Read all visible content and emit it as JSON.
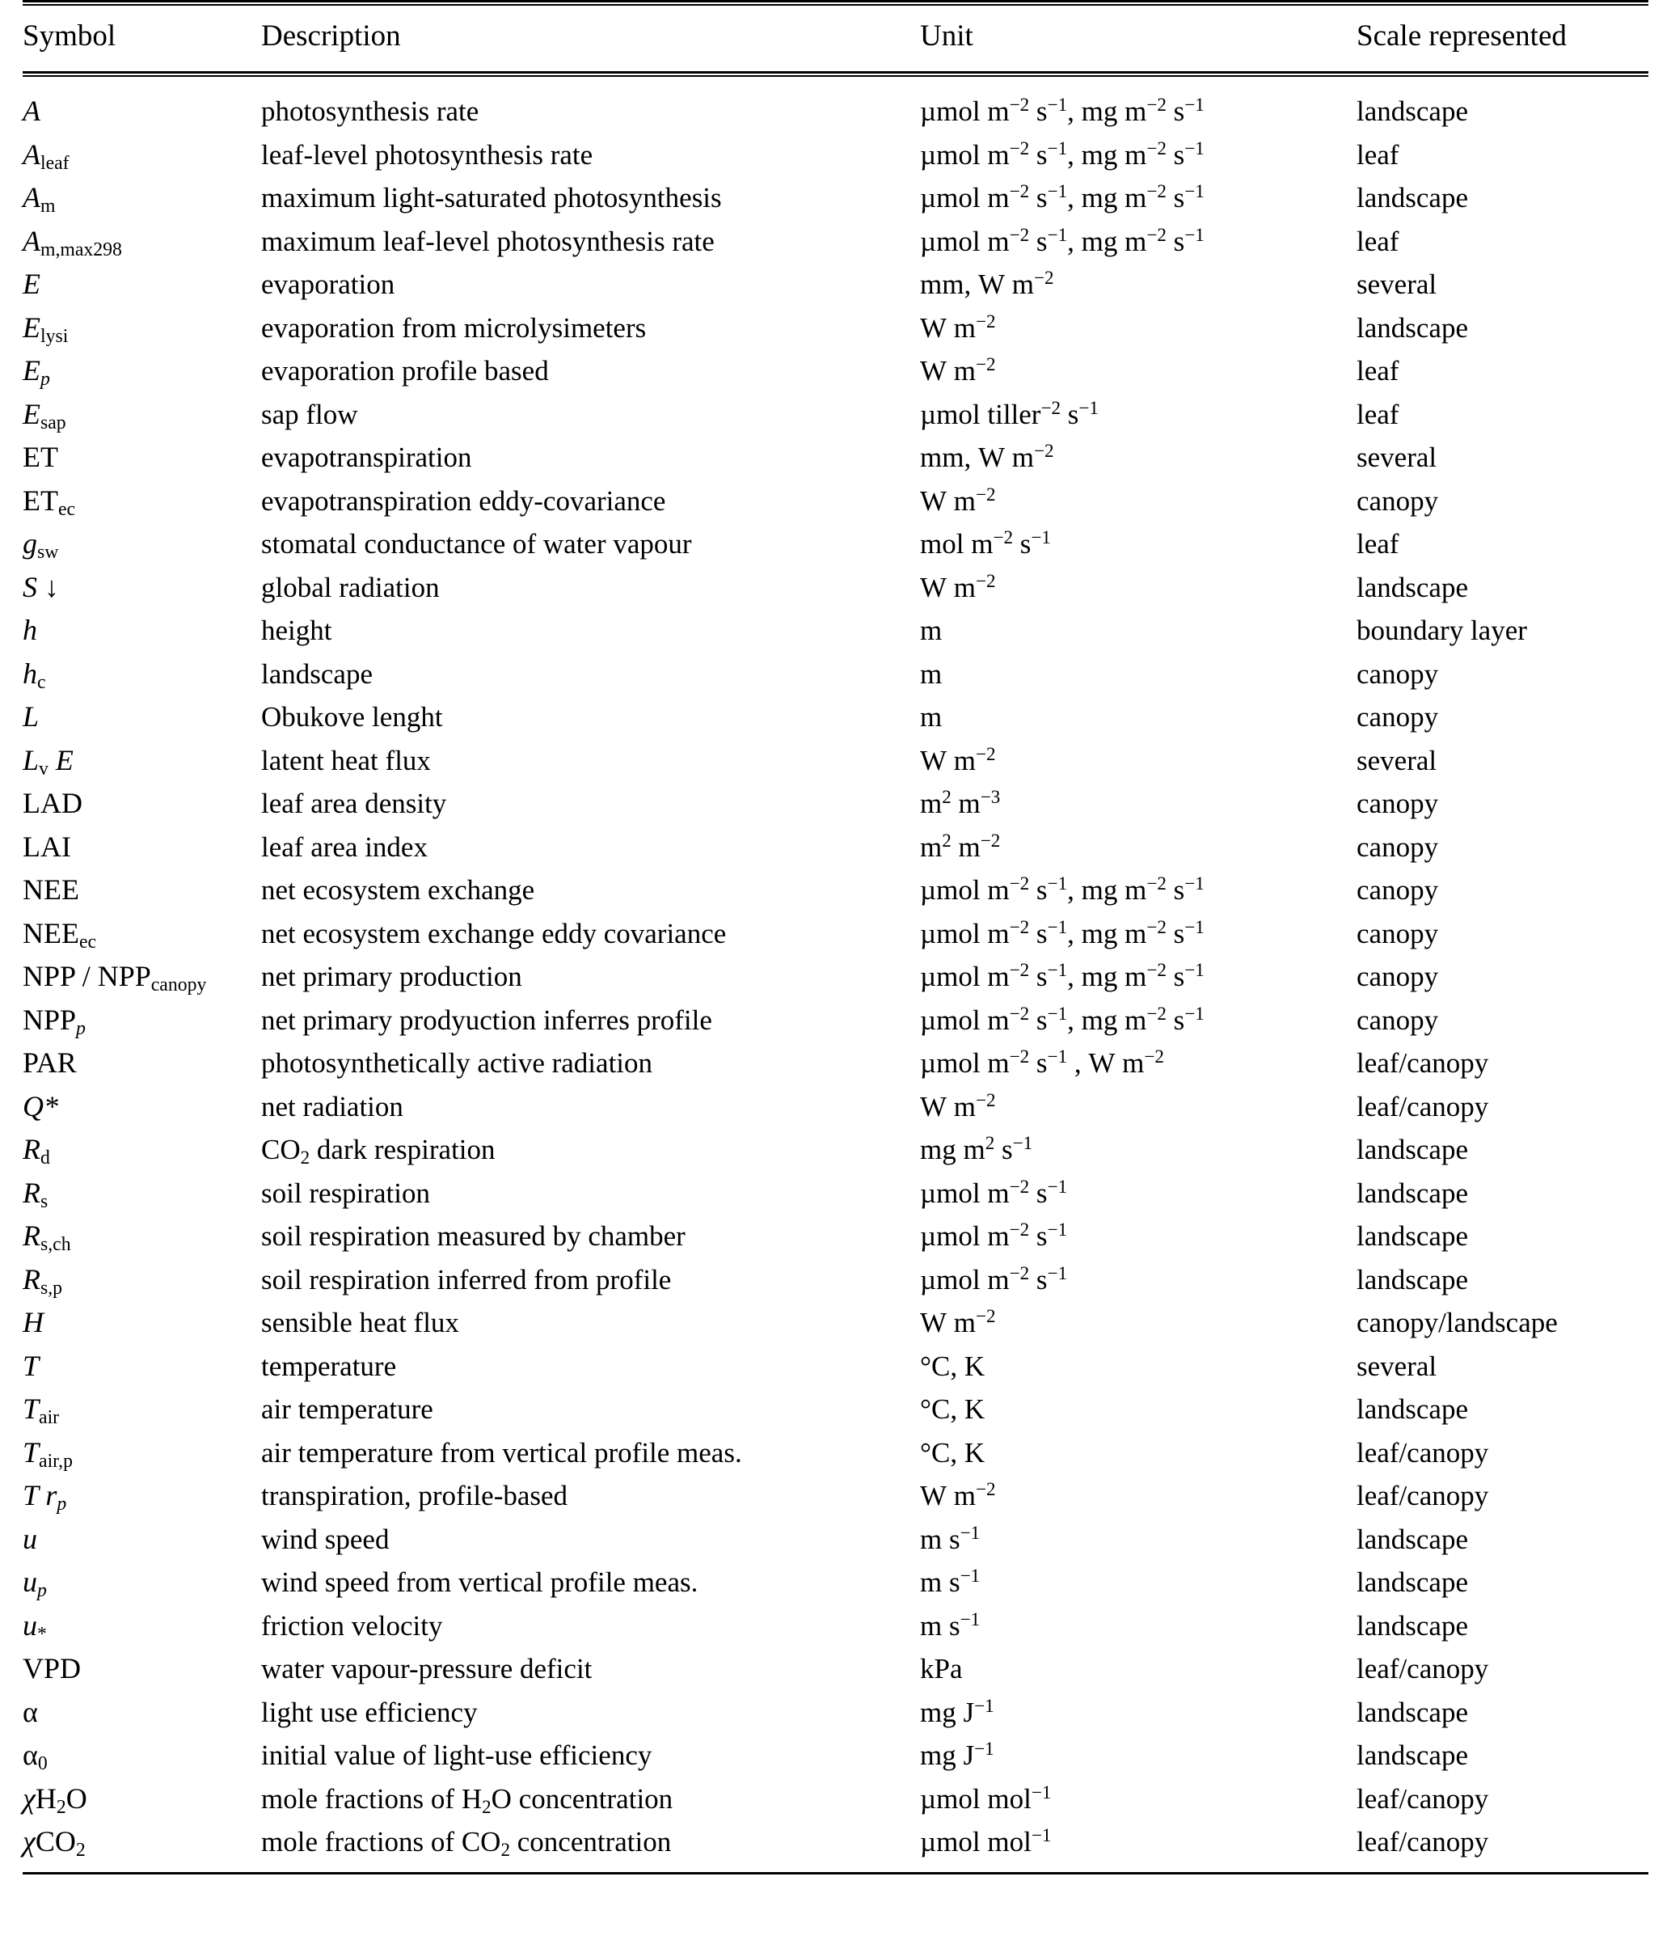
{
  "table": {
    "columns": [
      "Symbol",
      "Description",
      "Unit",
      "Scale represented"
    ],
    "rows": [
      {
        "symbol": "A",
        "symbol_base": "A",
        "symbol_sub": "",
        "description": "photosynthesis rate",
        "unit": "µmol m−2 s−1, mg m−2 s−1",
        "scale": "landscape"
      },
      {
        "symbol": "Aleaf",
        "symbol_base": "A",
        "symbol_sub": "leaf",
        "description": "leaf-level photosynthesis rate",
        "unit": "µmol m−2 s−1, mg m−2 s−1",
        "scale": "leaf"
      },
      {
        "symbol": "Am",
        "symbol_base": "A",
        "symbol_sub": "m",
        "description": "maximum light-saturated photosynthesis",
        "unit": "µmol m−2 s−1, mg m−2 s−1",
        "scale": "landscape"
      },
      {
        "symbol": "Am,max298",
        "symbol_base": "A",
        "symbol_sub": "m,max298",
        "description": "maximum leaf-level photosynthesis rate",
        "unit": "µmol m−2 s−1, mg m−2 s−1",
        "scale": "leaf"
      },
      {
        "symbol": "E",
        "symbol_base": "E",
        "symbol_sub": "",
        "description": "evaporation",
        "unit": "mm, W m−2",
        "scale": "several"
      },
      {
        "symbol": "Elysi",
        "symbol_base": "E",
        "symbol_sub": "lysi",
        "description": "evaporation from microlysimeters",
        "unit": "W m−2",
        "scale": "landscape"
      },
      {
        "symbol": "Ep",
        "symbol_base": "E",
        "symbol_sub": "p",
        "description": "evaporation profile based",
        "unit": "W m−2",
        "scale": "leaf"
      },
      {
        "symbol": "Esap",
        "symbol_base": "E",
        "symbol_sub": "sap",
        "description": "sap flow",
        "unit": "µmol tiller−2 s−1",
        "scale": "leaf"
      },
      {
        "symbol": "ET",
        "symbol_base": "ET",
        "symbol_sub": "",
        "description": "evapotranspiration",
        "unit": "mm, W m−2",
        "scale": "several"
      },
      {
        "symbol": "ETec",
        "symbol_base": "ET",
        "symbol_sub": "ec",
        "description": "evapotranspiration eddy-covariance",
        "unit": "W m−2",
        "scale": "canopy"
      },
      {
        "symbol": "gsw",
        "symbol_base": "g",
        "symbol_sub": "sw",
        "description": "stomatal conductance of water vapour",
        "unit": "mol m−2 s−1",
        "scale": "leaf"
      },
      {
        "symbol": "S↓",
        "symbol_base": "S ↓",
        "symbol_sub": "",
        "description": "global radiation",
        "unit": "W m−2",
        "scale": "landscape"
      },
      {
        "symbol": "h",
        "symbol_base": "h",
        "symbol_sub": "",
        "description": "height",
        "unit": "m",
        "scale": "boundary layer"
      },
      {
        "symbol": "hc",
        "symbol_base": "h",
        "symbol_sub": "c",
        "description": "landscape",
        "unit": "m",
        "scale": "canopy"
      },
      {
        "symbol": "L",
        "symbol_base": "L",
        "symbol_sub": "",
        "description": "Obukove lenght",
        "unit": "m",
        "scale": "canopy"
      },
      {
        "symbol": "LvE",
        "symbol_base": "L",
        "symbol_sub": "v",
        "description": "latent heat flux",
        "unit": "W m−2",
        "scale": "several"
      },
      {
        "symbol": "LAD",
        "symbol_base": "LAD",
        "symbol_sub": "",
        "description": "leaf area density",
        "unit": "m2 m−3",
        "scale": "canopy"
      },
      {
        "symbol": "LAI",
        "symbol_base": "LAI",
        "symbol_sub": "",
        "description": "leaf area index",
        "unit": "m2 m−2",
        "scale": "canopy"
      },
      {
        "symbol": "NEE",
        "symbol_base": "NEE",
        "symbol_sub": "",
        "description": "net ecosystem exchange",
        "unit": "µmol m−2 s−1, mg m−2 s−1",
        "scale": "canopy"
      },
      {
        "symbol": "NEEec",
        "symbol_base": "NEE",
        "symbol_sub": "ec",
        "description": "net ecosystem exchange eddy covariance",
        "unit": "µmol m−2 s−1, mg m−2 s−1",
        "scale": "canopy"
      },
      {
        "symbol": "NPP / NPPcanopy",
        "symbol_base": "NPP / NPP",
        "symbol_sub": "canopy",
        "description": "net primary production",
        "unit": "µmol m−2 s−1, mg m−2 s−1",
        "scale": "canopy"
      },
      {
        "symbol": "NPPp",
        "symbol_base": "NPP",
        "symbol_sub": "p",
        "description": "net primary prodyuction inferres profile",
        "unit": "µmol m−2 s−1, mg m−2 s−1",
        "scale": "canopy"
      },
      {
        "symbol": "PAR",
        "symbol_base": "PAR",
        "symbol_sub": "",
        "description": "photosynthetically active radiation",
        "unit": "µmol m−2 s−1 , W m−2",
        "scale": "leaf/canopy"
      },
      {
        "symbol": "Q*",
        "symbol_base": "Q*",
        "symbol_sub": "",
        "description": "net radiation",
        "unit": "W m−2",
        "scale": "leaf/canopy"
      },
      {
        "symbol": "Rd",
        "symbol_base": "R",
        "symbol_sub": "d",
        "description": "CO2 dark respiration",
        "unit": "mg m2 s−1",
        "scale": "landscape"
      },
      {
        "symbol": "Rs",
        "symbol_base": "R",
        "symbol_sub": "s",
        "description": "soil respiration",
        "unit": "µmol m−2 s−1",
        "scale": "landscape"
      },
      {
        "symbol": "Rs,ch",
        "symbol_base": "R",
        "symbol_sub": "s,ch",
        "description": "soil respiration measured by chamber",
        "unit": "µmol m−2 s−1",
        "scale": "landscape"
      },
      {
        "symbol": "Rs,p",
        "symbol_base": "R",
        "symbol_sub": "s,p",
        "description": "soil respiration inferred from profile",
        "unit": "µmol m−2 s−1",
        "scale": "landscape"
      },
      {
        "symbol": "H",
        "symbol_base": "H",
        "symbol_sub": "",
        "description": "sensible heat flux",
        "unit": "W m−2",
        "scale": "canopy/landscape"
      },
      {
        "symbol": "T",
        "symbol_base": "T",
        "symbol_sub": "",
        "description": "temperature",
        "unit": "°C, K",
        "scale": "several"
      },
      {
        "symbol": "Tair",
        "symbol_base": "T",
        "symbol_sub": "air",
        "description": "air temperature",
        "unit": "°C, K",
        "scale": "landscape"
      },
      {
        "symbol": "Tair,p",
        "symbol_base": "T",
        "symbol_sub": "air,p",
        "description": "air temperature from vertical profile meas.",
        "unit": "°C, K",
        "scale": "leaf/canopy"
      },
      {
        "symbol": "Trp",
        "symbol_base": "T r",
        "symbol_sub": "p",
        "description": "transpiration, profile-based",
        "unit": "W m−2",
        "scale": "leaf/canopy"
      },
      {
        "symbol": "u",
        "symbol_base": "u",
        "symbol_sub": "",
        "description": "wind speed",
        "unit": "m s−1",
        "scale": "landscape"
      },
      {
        "symbol": "up",
        "symbol_base": "u",
        "symbol_sub": "p",
        "description": "wind speed from vertical profile meas.",
        "unit": "m s−1",
        "scale": "landscape"
      },
      {
        "symbol": "u*",
        "symbol_base": "u",
        "symbol_sub": "*",
        "description": "friction velocity",
        "unit": "m s−1",
        "scale": "landscape"
      },
      {
        "symbol": "VPD",
        "symbol_base": "VPD",
        "symbol_sub": "",
        "description": "water vapour-pressure deficit",
        "unit": "kPa",
        "scale": "leaf/canopy"
      },
      {
        "symbol": "α",
        "symbol_base": "α",
        "symbol_sub": "",
        "description": "light use efficiency",
        "unit": "mg J−1",
        "scale": "landscape"
      },
      {
        "symbol": "α0",
        "symbol_base": "α",
        "symbol_sub": "0",
        "description": "initial value of light-use efficiency",
        "unit": "mg J−1",
        "scale": "landscape"
      },
      {
        "symbol": "χH2O",
        "symbol_base": "χH",
        "symbol_sub": "2",
        "description": "mole fractions of H2O concentration",
        "unit": "µmol mol−1",
        "scale": "leaf/canopy"
      },
      {
        "symbol": "χCO2",
        "symbol_base": "χCO",
        "symbol_sub": "2",
        "description": "mole fractions of CO2 concentration",
        "unit": "µmol mol−1",
        "scale": "leaf/canopy"
      }
    ]
  }
}
